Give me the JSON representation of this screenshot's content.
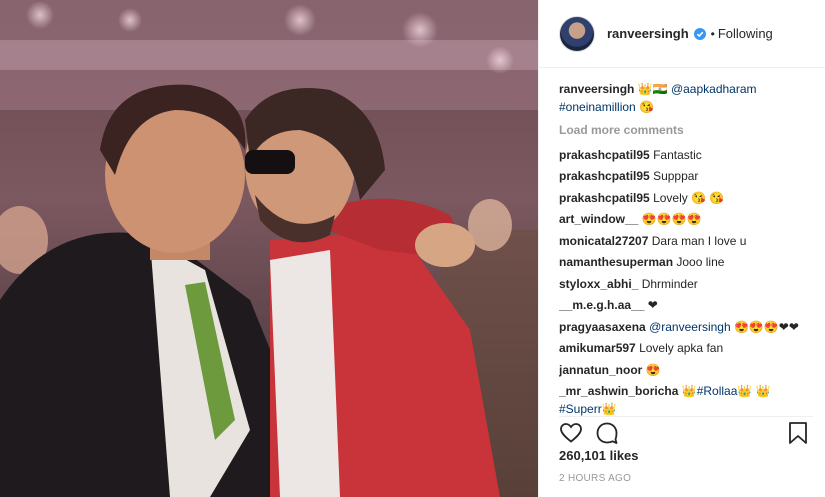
{
  "header": {
    "username": "ranveersingh",
    "separator": "•",
    "follow_label": "Following"
  },
  "caption": {
    "username": "ranveersingh",
    "emoji": "👑🇮🇳",
    "mention": "@aapkadharam",
    "hashtag": "#oneinamillion",
    "hashtag_emoji": "😘"
  },
  "load_more_label": "Load more comments",
  "comments": [
    {
      "user": "prakashcpatil95",
      "text": "Fantastic"
    },
    {
      "user": "prakashcpatil95",
      "text": "Supppar"
    },
    {
      "user": "prakashcpatil95",
      "text": "Lovely 😘 😘"
    },
    {
      "user": "art_window__",
      "text": "😍😍😍😍"
    },
    {
      "user": "monicatal27207",
      "text": "Dara man I love u"
    },
    {
      "user": "namanthesuperman",
      "text": "Jooo line"
    },
    {
      "user": "styloxx_abhi_",
      "text": "Dhrminder"
    },
    {
      "user": "__m.e.g.h.aa__",
      "text": "❤"
    },
    {
      "user": "pragyaasaxena",
      "mention": "@ranveersingh",
      "text": "😍😍😍❤❤"
    },
    {
      "user": "amikumar597",
      "text": "Lovely apka fan"
    },
    {
      "user": "jannatun_noor",
      "text": "😍"
    },
    {
      "user": "_mr_ashwin_boricha",
      "text": "👑",
      "hashtag": "#Rollaa",
      "text2": "👑 👑",
      "hashtag2": "#Superr",
      "text3": "👑"
    }
  ],
  "likes_label": "260,101 likes",
  "timestamp": "2 HOURS AGO",
  "icons": {
    "like": "heart-icon",
    "comment": "comment-icon",
    "save": "bookmark-icon",
    "verified": "verified-badge-icon"
  }
}
